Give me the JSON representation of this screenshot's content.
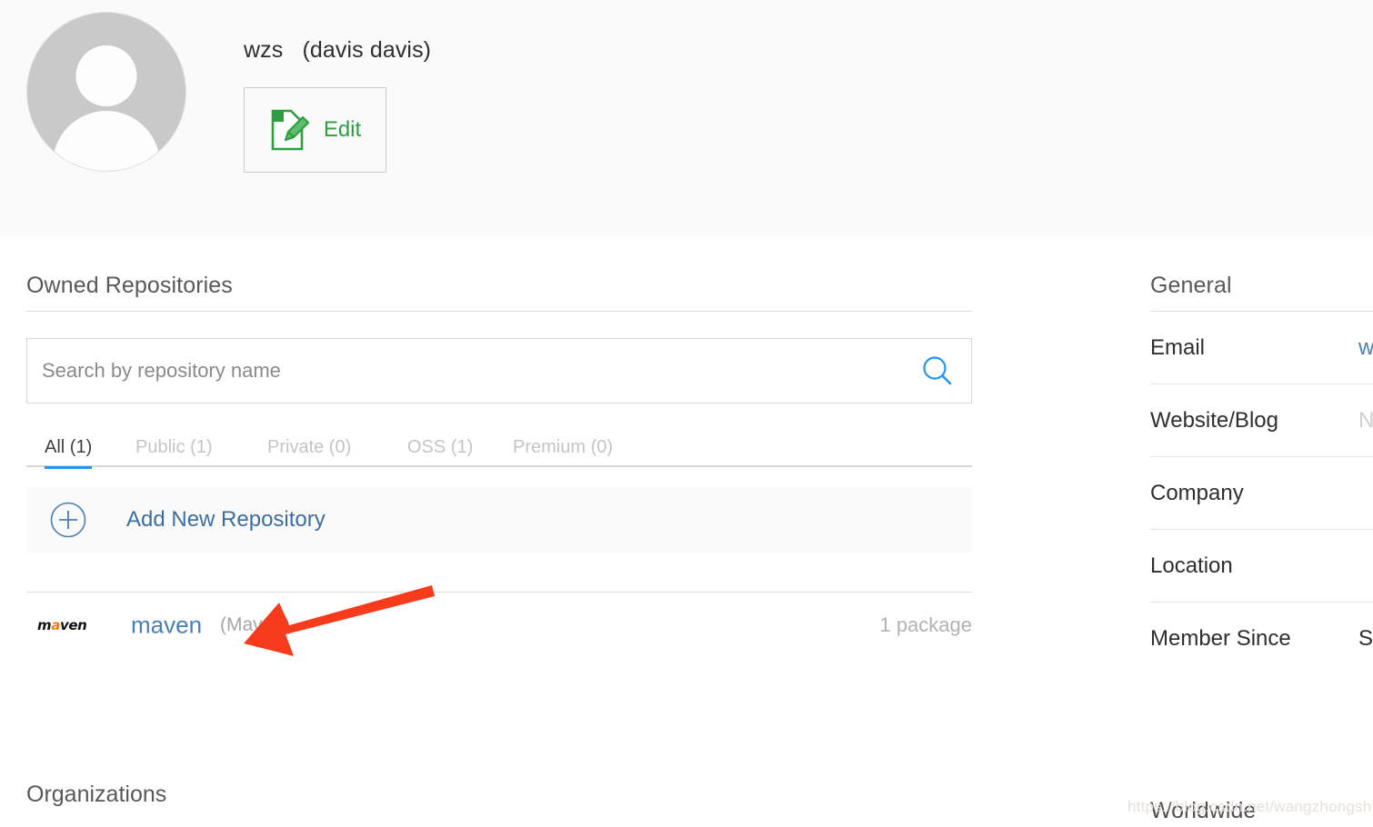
{
  "profile": {
    "display_name": "wzs   (davis davis)",
    "avatar_icon": "default-user-avatar-icon",
    "edit_button_label": "Edit",
    "edit_icon": "document-pencil-edit-icon"
  },
  "repositories": {
    "section_title": "Owned Repositories",
    "search": {
      "placeholder": "Search by repository name",
      "value": "",
      "icon": "search-icon"
    },
    "tabs": [
      {
        "label": "All (1)",
        "active": true
      },
      {
        "label": "Public (1)",
        "active": false
      },
      {
        "label": "Private (0)",
        "active": false
      },
      {
        "label": "OSS (1)",
        "active": false
      },
      {
        "label": "Premium (0)",
        "active": false
      }
    ],
    "add_new": {
      "label": "Add New Repository",
      "icon": "plus-circle-icon"
    },
    "rows": [
      {
        "logo_text_a": "m",
        "logo_text_b": "a",
        "logo_text_c": "ven",
        "logo_icon": "maven-logo-icon",
        "name": "maven",
        "type": "(Maven)",
        "packages": "1 package"
      }
    ]
  },
  "organizations": {
    "section_title": "Organizations"
  },
  "sidebar": {
    "section_title": "General",
    "rows": [
      {
        "label": "Email",
        "value": "w",
        "style": "link"
      },
      {
        "label": "Website/Blog",
        "value": "N",
        "style": "muted"
      },
      {
        "label": "Company",
        "value": "",
        "style": "plain"
      },
      {
        "label": "Location",
        "value": "",
        "style": "plain"
      },
      {
        "label": "Member Since",
        "value": "S",
        "style": "plain"
      }
    ],
    "footer_title": "Worldwide"
  },
  "annotation": {
    "arrow_color": "#f93b1d",
    "arrow_icon": "red-pointer-arrow-icon"
  },
  "watermark": {
    "text": "https://blog.csdn.net/wangzhongshun"
  },
  "colors": {
    "accent_blue": "#2196f3",
    "link_blue": "#4a7fb5",
    "edit_green": "#2f9e41",
    "maven_orange": "#e8821b",
    "header_bg": "#fafafa"
  }
}
